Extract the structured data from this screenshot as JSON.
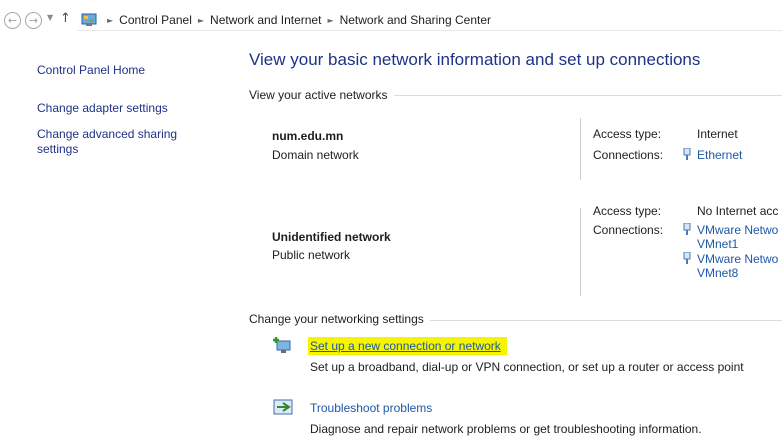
{
  "breadcrumb": {
    "items": [
      "Control Panel",
      "Network and Internet",
      "Network and Sharing Center"
    ]
  },
  "sidebar": {
    "home": "Control Panel Home",
    "links": [
      "Change adapter settings",
      "Change advanced sharing settings"
    ]
  },
  "main": {
    "title": "View your basic network information and set up connections",
    "active_networks_header": "View your active networks",
    "networks": [
      {
        "name": "num.edu.mn",
        "type": "Domain network",
        "access_type_label": "Access type:",
        "access_type": "Internet",
        "connections_label": "Connections:",
        "connections": [
          "Ethernet"
        ]
      },
      {
        "name": "Unidentified network",
        "type": "Public network",
        "access_type_label": "Access type:",
        "access_type": "No Internet acc",
        "connections_label": "Connections:",
        "connections": [
          "VMware Netwo",
          "VMnet1",
          "VMware Netwo",
          "VMnet8"
        ]
      }
    ],
    "settings_header": "Change your networking settings",
    "tasks": [
      {
        "link": "Set up a new connection or network",
        "description": "Set up a broadband, dial-up or VPN connection, or set up a router or access point",
        "highlighted": true
      },
      {
        "link": "Troubleshoot problems",
        "description": "Diagnose and repair network problems or get troubleshooting information."
      }
    ]
  },
  "colors": {
    "link": "#1e57a8",
    "nav_link": "#1e3287",
    "highlight": "#f5f500"
  },
  "icons": [
    "back-arrow-icon",
    "forward-arrow-icon",
    "recent-pages-chevron-icon",
    "up-arrow-icon",
    "control-panel-icon",
    "breadcrumb-separator-icon",
    "network-plug-icon",
    "new-connection-icon",
    "troubleshoot-icon"
  ]
}
